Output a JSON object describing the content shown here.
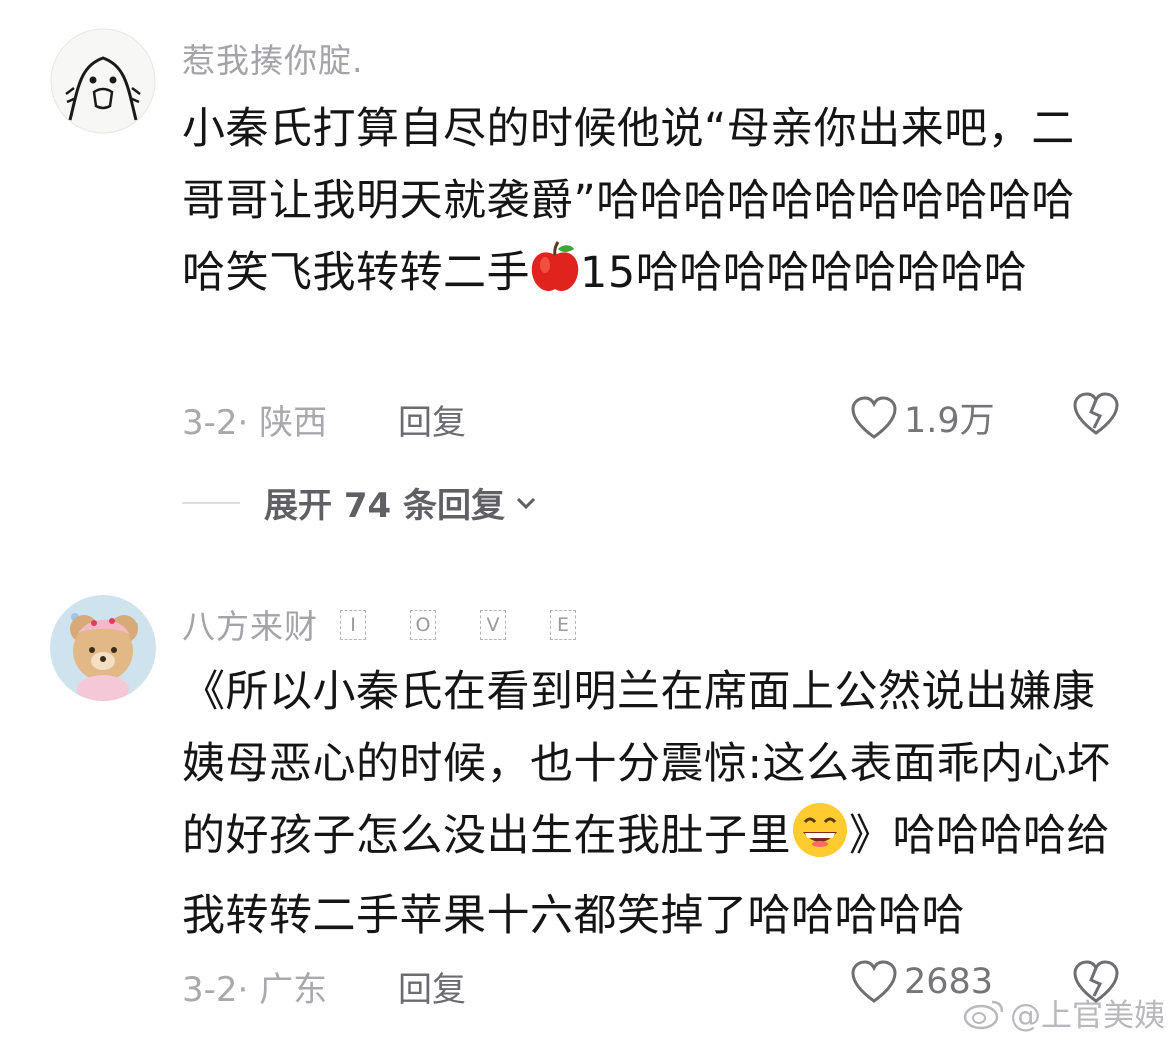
{
  "comments": [
    {
      "avatar_icon": "cartoon-face-avatar",
      "username": "惹我揍你腚.",
      "text_parts": [
        "小秦氏打算自尽的时候他说“母亲你出来吧，二哥哥让我明天就袭爵”哈哈哈哈哈哈哈哈哈哈哈哈笑飞我转转二手",
        "15哈哈哈哈哈哈哈哈哈"
      ],
      "emoji": "red-apple-emoji",
      "date": "3-2· 陕西",
      "reply_label": "回复",
      "like_count": "1.9万",
      "expand_label": "展开 74 条回复"
    },
    {
      "avatar_icon": "teddy-bear-avatar",
      "username": "八方来财",
      "username_tags": [
        "I",
        "O",
        "V",
        "E"
      ],
      "text_parts": [
        "《所以小秦氏在看到明兰在席面上公然说出嫌康姨母恶心的时候，也十分震惊:这么表面乖内心坏的好孩子怎么没出生在我肚子里",
        "》哈哈哈哈给我转转二手苹果十六都笑掉了哈哈哈哈哈"
      ],
      "emoji": "grinning-face-emoji",
      "date": "3-2· 广东",
      "reply_label": "回复",
      "like_count": "2683"
    }
  ],
  "watermark": "@上官美姨",
  "colors": {
    "text": "#151515",
    "muted": "#a3a3a8",
    "accent_red": "#e0241d"
  }
}
